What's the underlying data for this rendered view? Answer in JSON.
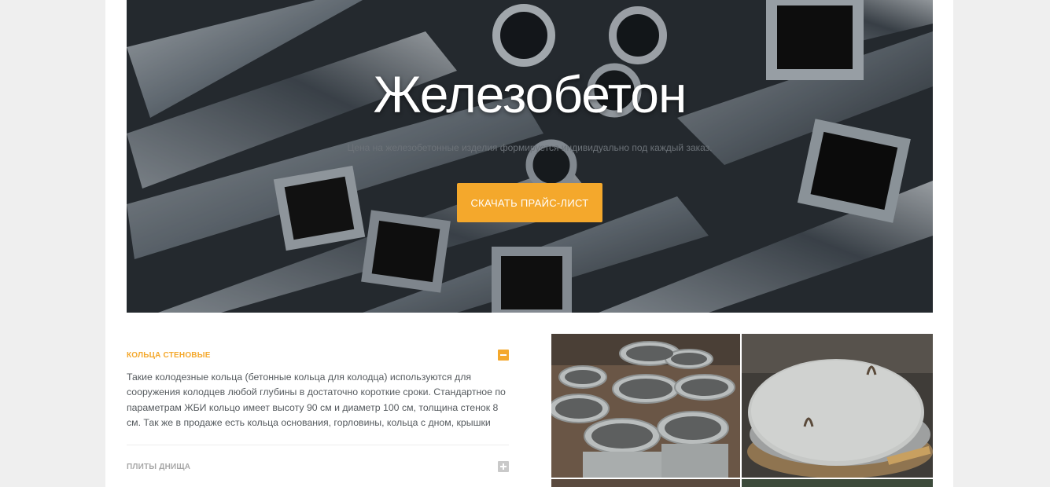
{
  "hero": {
    "title": "Железобетон",
    "subtitle": "Цена на железобетонные изделия формируется индивидуально под каждый заказ.",
    "button_label": "СКАЧАТЬ ПРАЙС-ЛИСТ"
  },
  "accordion": {
    "items": [
      {
        "title": "КОЛЬЦА СТЕНОВЫЕ",
        "expanded": true,
        "body": "Такие колодезные кольца (бетонные кольца для колодца) используются для сооружения колодцев любой глубины в достаточно короткие сроки. Стандартное по параметрам ЖБИ кольцо имеет высоту 90 см и диаметр 100 см, толщина стенок 8 см. Так же в продаже есть кольца основания, горловины, кольца с дном, крышки"
      },
      {
        "title": "ПЛИТЫ ДНИЩА",
        "expanded": false
      }
    ]
  },
  "colors": {
    "accent": "#f4a82c",
    "muted_toggle": "#c9c9c9",
    "page_bg": "#efefef"
  },
  "icons": {
    "expanded": "minus-icon",
    "collapsed": "plus-icon"
  }
}
